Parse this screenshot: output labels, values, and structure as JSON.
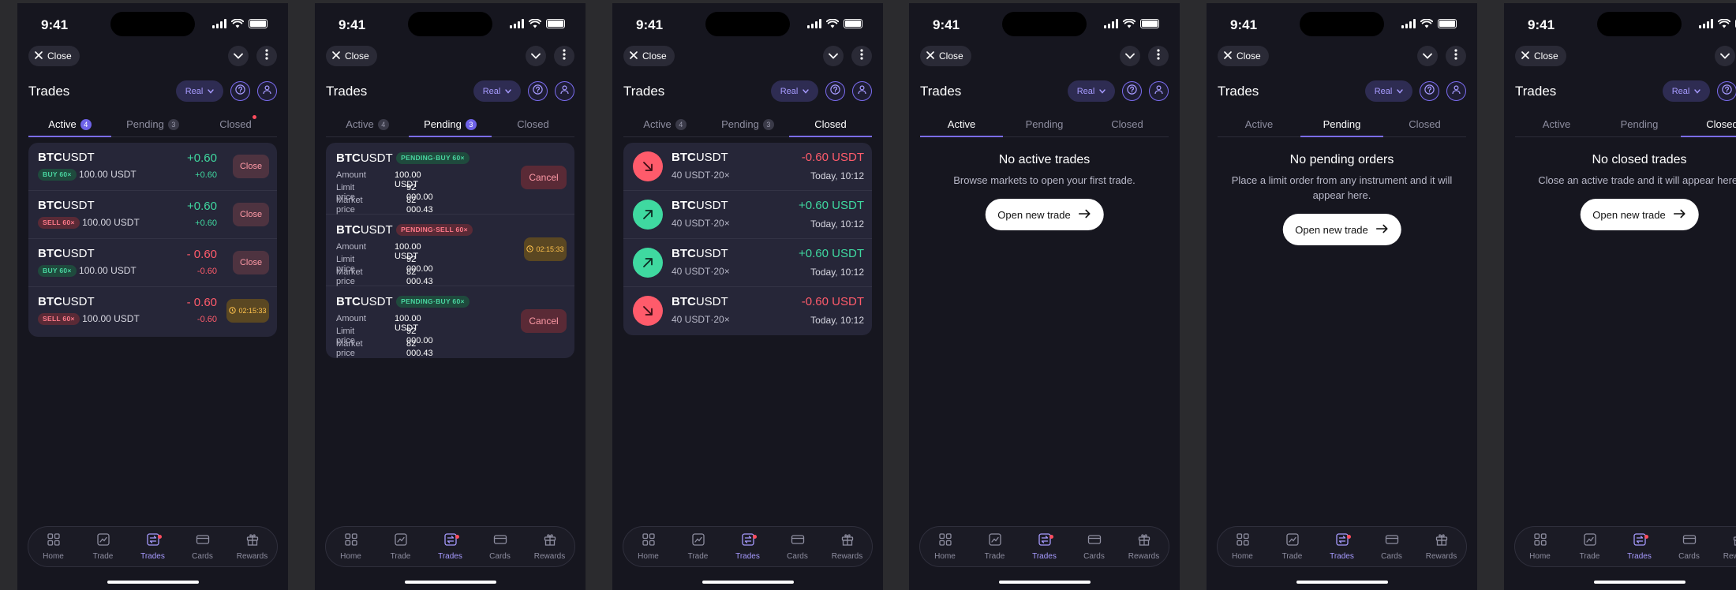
{
  "status": {
    "time": "9:41"
  },
  "topbar": {
    "close_label": "Close"
  },
  "header": {
    "title": "Trades",
    "account_label": "Real"
  },
  "tabs": {
    "active": "Active",
    "pending": "Pending",
    "closed": "Closed",
    "active_count": "4",
    "pending_count": "3"
  },
  "active_trades": [
    {
      "base": "BTC",
      "quote": "USDT",
      "tag": "BUY 60×",
      "amount": "100.00 USDT",
      "pnl": "+0.60",
      "pnl_sub": "+0.60",
      "action": "Close"
    },
    {
      "base": "BTC",
      "quote": "USDT",
      "tag": "SELL 60×",
      "amount": "100.00 USDT",
      "pnl": "+0.60",
      "pnl_sub": "+0.60",
      "action": "Close"
    },
    {
      "base": "BTC",
      "quote": "USDT",
      "tag": "BUY 60×",
      "amount": "100.00 USDT",
      "pnl": "- 0.60",
      "pnl_sub": "-0.60",
      "action": "Close"
    },
    {
      "base": "BTC",
      "quote": "USDT",
      "tag": "SELL 60×",
      "amount": "100.00 USDT",
      "pnl": "- 0.60",
      "pnl_sub": "-0.60",
      "action": "02:15:33"
    }
  ],
  "pending_labels": {
    "amount": "Amount",
    "limit": "Limit price",
    "market": "Market price",
    "cancel": "Cancel"
  },
  "pending_orders": [
    {
      "base": "BTC",
      "quote": "USDT",
      "tag": "PENDING·BUY 60×",
      "amount": "100.00 USDT",
      "limit": "92 000.00",
      "market": "82 000.43",
      "timer": ""
    },
    {
      "base": "BTC",
      "quote": "USDT",
      "tag": "PENDING·SELL 60×",
      "amount": "100.00 USDT",
      "limit": "92 000.00",
      "market": "82 000.43",
      "timer": "02:15:33"
    },
    {
      "base": "BTC",
      "quote": "USDT",
      "tag": "PENDING·BUY 60×",
      "amount": "100.00 USDT",
      "limit": "92 000.00",
      "market": "82 000.43",
      "timer": ""
    }
  ],
  "closed_trades": [
    {
      "base": "BTC",
      "quote": "USDT",
      "sub": "40 USDT·20×",
      "pnl": "-0.60 USDT",
      "time": "Today, 10:12"
    },
    {
      "base": "BTC",
      "quote": "USDT",
      "sub": "40 USDT·20×",
      "pnl": "+0.60 USDT",
      "time": "Today, 10:12"
    },
    {
      "base": "BTC",
      "quote": "USDT",
      "sub": "40 USDT·20×",
      "pnl": "+0.60 USDT",
      "time": "Today, 10:12"
    },
    {
      "base": "BTC",
      "quote": "USDT",
      "sub": "40 USDT·20×",
      "pnl": "-0.60 USDT",
      "time": "Today, 10:12"
    }
  ],
  "empty": {
    "active_title": "No active trades",
    "active_text": "Browse markets to open your first trade.",
    "pending_title": "No pending orders",
    "pending_text": "Place a limit order from any instrument and it will appear here.",
    "closed_title": "No closed trades",
    "closed_text": "Close an active trade and it will appear here.",
    "button": "Open new trade"
  },
  "nav": [
    "Home",
    "Trade",
    "Trades",
    "Cards",
    "Rewards"
  ],
  "colors": {
    "accent": "#7b6cf0",
    "positive": "#3fd9a0",
    "negative": "#ff5b6b",
    "background": "#16161f",
    "card": "#262638"
  }
}
